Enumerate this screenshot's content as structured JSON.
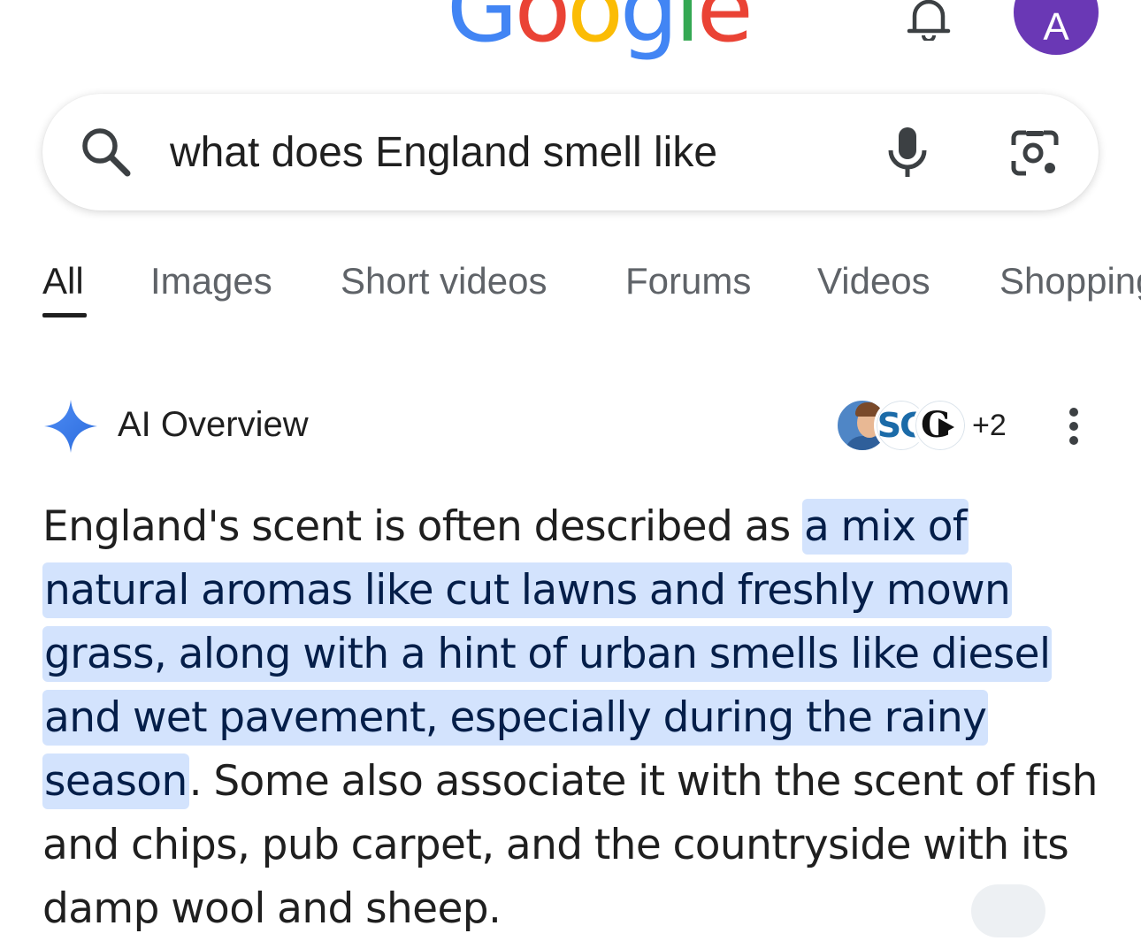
{
  "header": {
    "logo_letters": [
      "G",
      "o",
      "o",
      "g",
      "l",
      "e"
    ],
    "avatar_initial": "A",
    "bell_icon": "bell-icon",
    "colors": {
      "blue": "#4285f4",
      "red": "#ea4335",
      "yellow": "#fbbc05",
      "green": "#34a853",
      "avatar": "#6a38b5"
    }
  },
  "search": {
    "query": "what does England smell like",
    "search_icon": "search-icon",
    "voice_icon": "mic-icon",
    "lens_icon": "lens-icon"
  },
  "tabs": [
    {
      "label": "All",
      "active": true
    },
    {
      "label": "Images",
      "active": false
    },
    {
      "label": "Short videos",
      "active": false
    },
    {
      "label": "Forums",
      "active": false
    },
    {
      "label": "Videos",
      "active": false
    },
    {
      "label": "Shopping",
      "active": false
    }
  ],
  "ai_overview": {
    "title": "AI Overview",
    "icon": "sparkle-icon",
    "source_count_extra": "+2",
    "more_icon": "more-vert-icon",
    "source_icons": [
      "avatar-photo",
      "SG",
      "G"
    ],
    "highlight_color": "#d3e3fd",
    "paragraph": {
      "lead": "England's scent is often described as ",
      "highlight": "a mix of natural aromas like cut lawns and freshly mown grass, along with a hint of urban smells like diesel and wet pavement, especially during the rainy season",
      "tail": ". Some also associate it with the scent of fish and chips, pub carpet, and the countryside with its damp wool and sheep."
    }
  }
}
